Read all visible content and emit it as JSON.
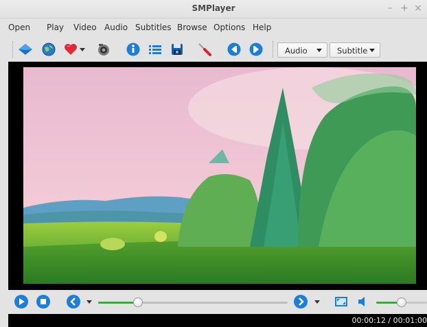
{
  "window": {
    "title": "SMPlayer"
  },
  "menu": [
    "Open",
    "Play",
    "Video",
    "Audio",
    "Subtitles",
    "Browse",
    "Options",
    "Help"
  ],
  "toolbar": {
    "audio_combo": "Audio",
    "subtitle_combo": "Subtitle"
  },
  "playback": {
    "progress": 0.21,
    "volume": 0.5
  },
  "status": {
    "time": "00:00:12 / 00:01:00"
  },
  "colors": {
    "accent": "#1f7fd6",
    "slider": "#3ea83e"
  }
}
